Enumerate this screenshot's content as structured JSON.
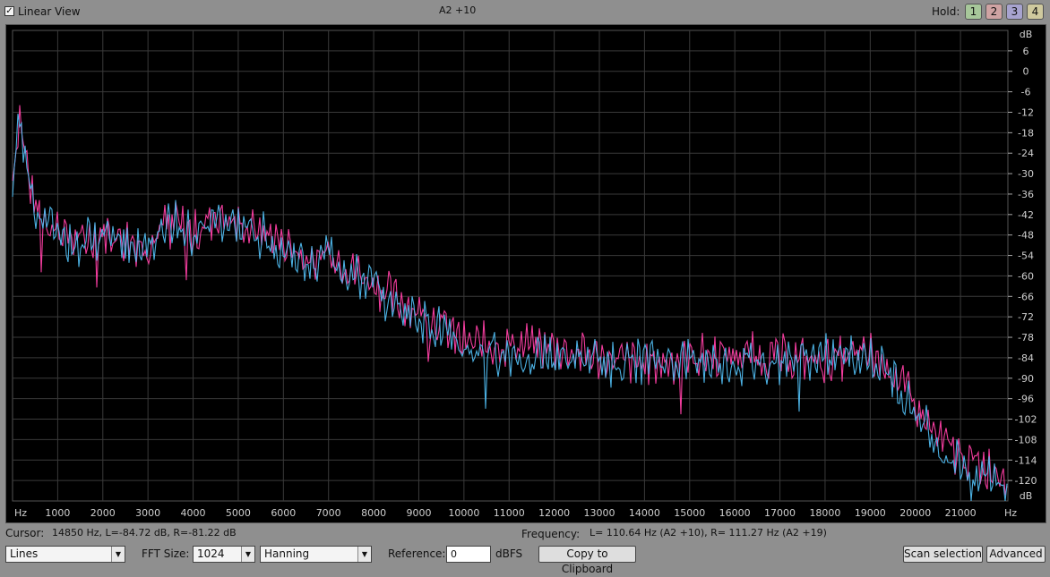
{
  "topbar": {
    "linear_view_label": "Linear View",
    "linear_view_checked": true,
    "title": "A2 +10",
    "hold_label": "Hold:",
    "hold_buttons": [
      "1",
      "2",
      "3",
      "4"
    ]
  },
  "colors": {
    "background": "#000000",
    "grid": "#3a3a3a",
    "left_channel": "#ff3fa5",
    "right_channel": "#4fb9ee"
  },
  "chart_data": {
    "type": "line",
    "x_unit_label": "Hz",
    "y_unit_label": "dB",
    "xlim": [
      0,
      22050
    ],
    "ylim": [
      -126,
      12
    ],
    "x_ticks": [
      1000,
      2000,
      3000,
      4000,
      5000,
      6000,
      7000,
      8000,
      9000,
      10000,
      11000,
      12000,
      13000,
      14000,
      15000,
      16000,
      17000,
      18000,
      19000,
      20000,
      21000
    ],
    "y_ticks": [
      6,
      0,
      -6,
      -12,
      -18,
      -24,
      -30,
      -36,
      -42,
      -48,
      -54,
      -60,
      -66,
      -72,
      -78,
      -84,
      -90,
      -96,
      -102,
      -108,
      -114,
      -120
    ],
    "x": [
      0,
      150,
      300,
      450,
      600,
      900,
      1200,
      1500,
      2000,
      2500,
      3000,
      3500,
      4000,
      4500,
      5000,
      5500,
      6000,
      6500,
      7000,
      7500,
      8000,
      8500,
      9000,
      9500,
      10000,
      11000,
      12000,
      13000,
      14000,
      15000,
      16000,
      17000,
      18000,
      19000,
      19500,
      20000,
      20500,
      21000,
      21500,
      22000
    ],
    "series": [
      {
        "values": [
          -32,
          -12,
          -26,
          -38,
          -42,
          -45,
          -48,
          -50,
          -47,
          -49,
          -51,
          -43,
          -48,
          -42,
          -45,
          -47,
          -50,
          -55,
          -52,
          -58,
          -62,
          -67,
          -70,
          -74,
          -80,
          -80,
          -81,
          -84,
          -86,
          -84,
          -83,
          -84,
          -85,
          -83,
          -88,
          -98,
          -108,
          -113,
          -116,
          -117
        ]
      },
      {
        "values": [
          -34,
          -13,
          -27,
          -39,
          -41,
          -46,
          -47,
          -51,
          -48,
          -50,
          -50,
          -44,
          -49,
          -43,
          -46,
          -48,
          -52,
          -57,
          -53,
          -60,
          -63,
          -69,
          -72,
          -76,
          -82,
          -83,
          -84,
          -86,
          -85,
          -85,
          -86,
          -85,
          -84,
          -84,
          -90,
          -100,
          -111,
          -115,
          -118,
          -121
        ]
      }
    ]
  },
  "status": {
    "cursor_label": "Cursor:",
    "cursor_value": "14850 Hz, L=-84.72 dB, R=-81.22 dB",
    "frequency_label": "Frequency:",
    "frequency_value": "L= 110.64 Hz (A2 +10), R= 111.27 Hz (A2 +19)"
  },
  "controls": {
    "mode_select": "Lines",
    "fft_label": "FFT Size:",
    "fft_size": "1024",
    "window_select": "Hanning",
    "reference_label": "Reference:",
    "reference_value": "0",
    "reference_unit": "dBFS",
    "copy_button": "Copy to Clipboard",
    "scan_button": "Scan selection",
    "advanced_button": "Advanced"
  }
}
